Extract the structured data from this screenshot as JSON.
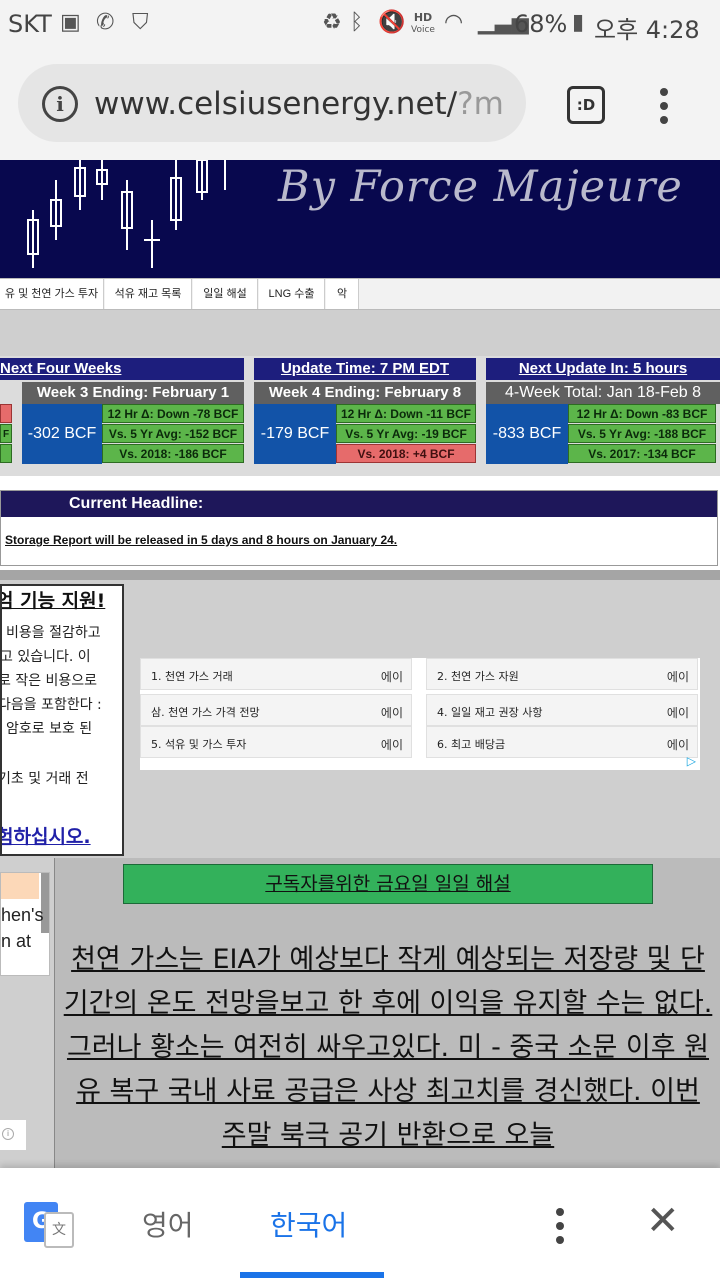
{
  "status_bar": {
    "carrier": "SKT",
    "battery_percent": "68%",
    "time": "오후 4:28",
    "hd_label": "HD",
    "voice_label": "Voice"
  },
  "browser": {
    "url_main": "www.celsiusenergy.net/",
    "url_faded": "?m",
    "tabs_label": ":D"
  },
  "banner": {
    "brand": "By Force Majeure"
  },
  "nav_tabs": [
    "유 및 천연 가스 투자",
    "석유 재고 목록",
    "일일 해설",
    "LNG 수출",
    "악"
  ],
  "panels": {
    "left_header": "Next Four Weeks",
    "mid_header": "Update Time: 7 PM EDT",
    "right_header": "Next Update In: 5 hours",
    "week3": {
      "title": "Week 3 Ending: February 1",
      "bcf": "-302 BCF",
      "stats": [
        "12 Hr Δ: Down -78 BCF",
        "Vs. 5 Yr Avg: -152 BCF",
        "Vs. 2018: -186 BCF"
      ]
    },
    "week4": {
      "title": "Week 4 Ending: February 8",
      "bcf": "-179 BCF",
      "stats": [
        "12 Hr Δ: Down -11 BCF",
        "Vs. 5 Yr Avg: -19 BCF",
        "Vs. 2018: +4 BCF"
      ]
    },
    "total": {
      "title": "4-Week Total: Jan 18-Feb 8",
      "bcf": "-833 BCF",
      "stats": [
        "12 Hr Δ: Down -83 BCF",
        "Vs. 5 Yr Avg: -188 BCF",
        "Vs. 2017: -134 BCF"
      ]
    },
    "left_partial_stat": "F"
  },
  "headline": {
    "title": "Current Headline:",
    "text": "Storage Report will be released in 5 days and 8 hours on January 24."
  },
  "korean_promo": {
    "title": "엄 기능 지원!",
    "lines": [
      "비용을 절감하고",
      "고 있습니다. 이",
      "로 작은 비용으로",
      "다음을 포함한다 :",
      "암호로 보호 된",
      "",
      "기초 및 거래 전"
    ],
    "link": "험하십시오."
  },
  "ads": [
    {
      "label": "1. 천연 가스 거래",
      "arrow": "에이"
    },
    {
      "label": "2. 천연 가스 자원",
      "arrow": "에이"
    },
    {
      "label": "삼. 천연 가스 가격 전망",
      "arrow": "에이"
    },
    {
      "label": "4. 일일 재고 권장 사항",
      "arrow": "에이"
    },
    {
      "label": "5. 석유 및 가스 투자",
      "arrow": "에이"
    },
    {
      "label": "6. 최고 배당금",
      "arrow": "에이"
    }
  ],
  "left_partial": {
    "line1": "hen's",
    "line2": "n at",
    "info": "i"
  },
  "article": {
    "green_banner": "구독자를위한 금요일 일일 해설",
    "body": "천연 가스는 EIA가 예상보다 작게 예상되는 저장량 및 단기간의 온도 전망을보고 한 후에 이익을 유지할 수는 없다. 그러나 황소는 여전히 싸우고있다. 미 - 중국 소문 이후 원유 복구 국내 사료 공급은 사상 최고치를 경신했다. 이번 주말 북극 공기 반환으로 오늘"
  },
  "translate_bar": {
    "source_lang": "영어",
    "target_lang": "한국어"
  }
}
